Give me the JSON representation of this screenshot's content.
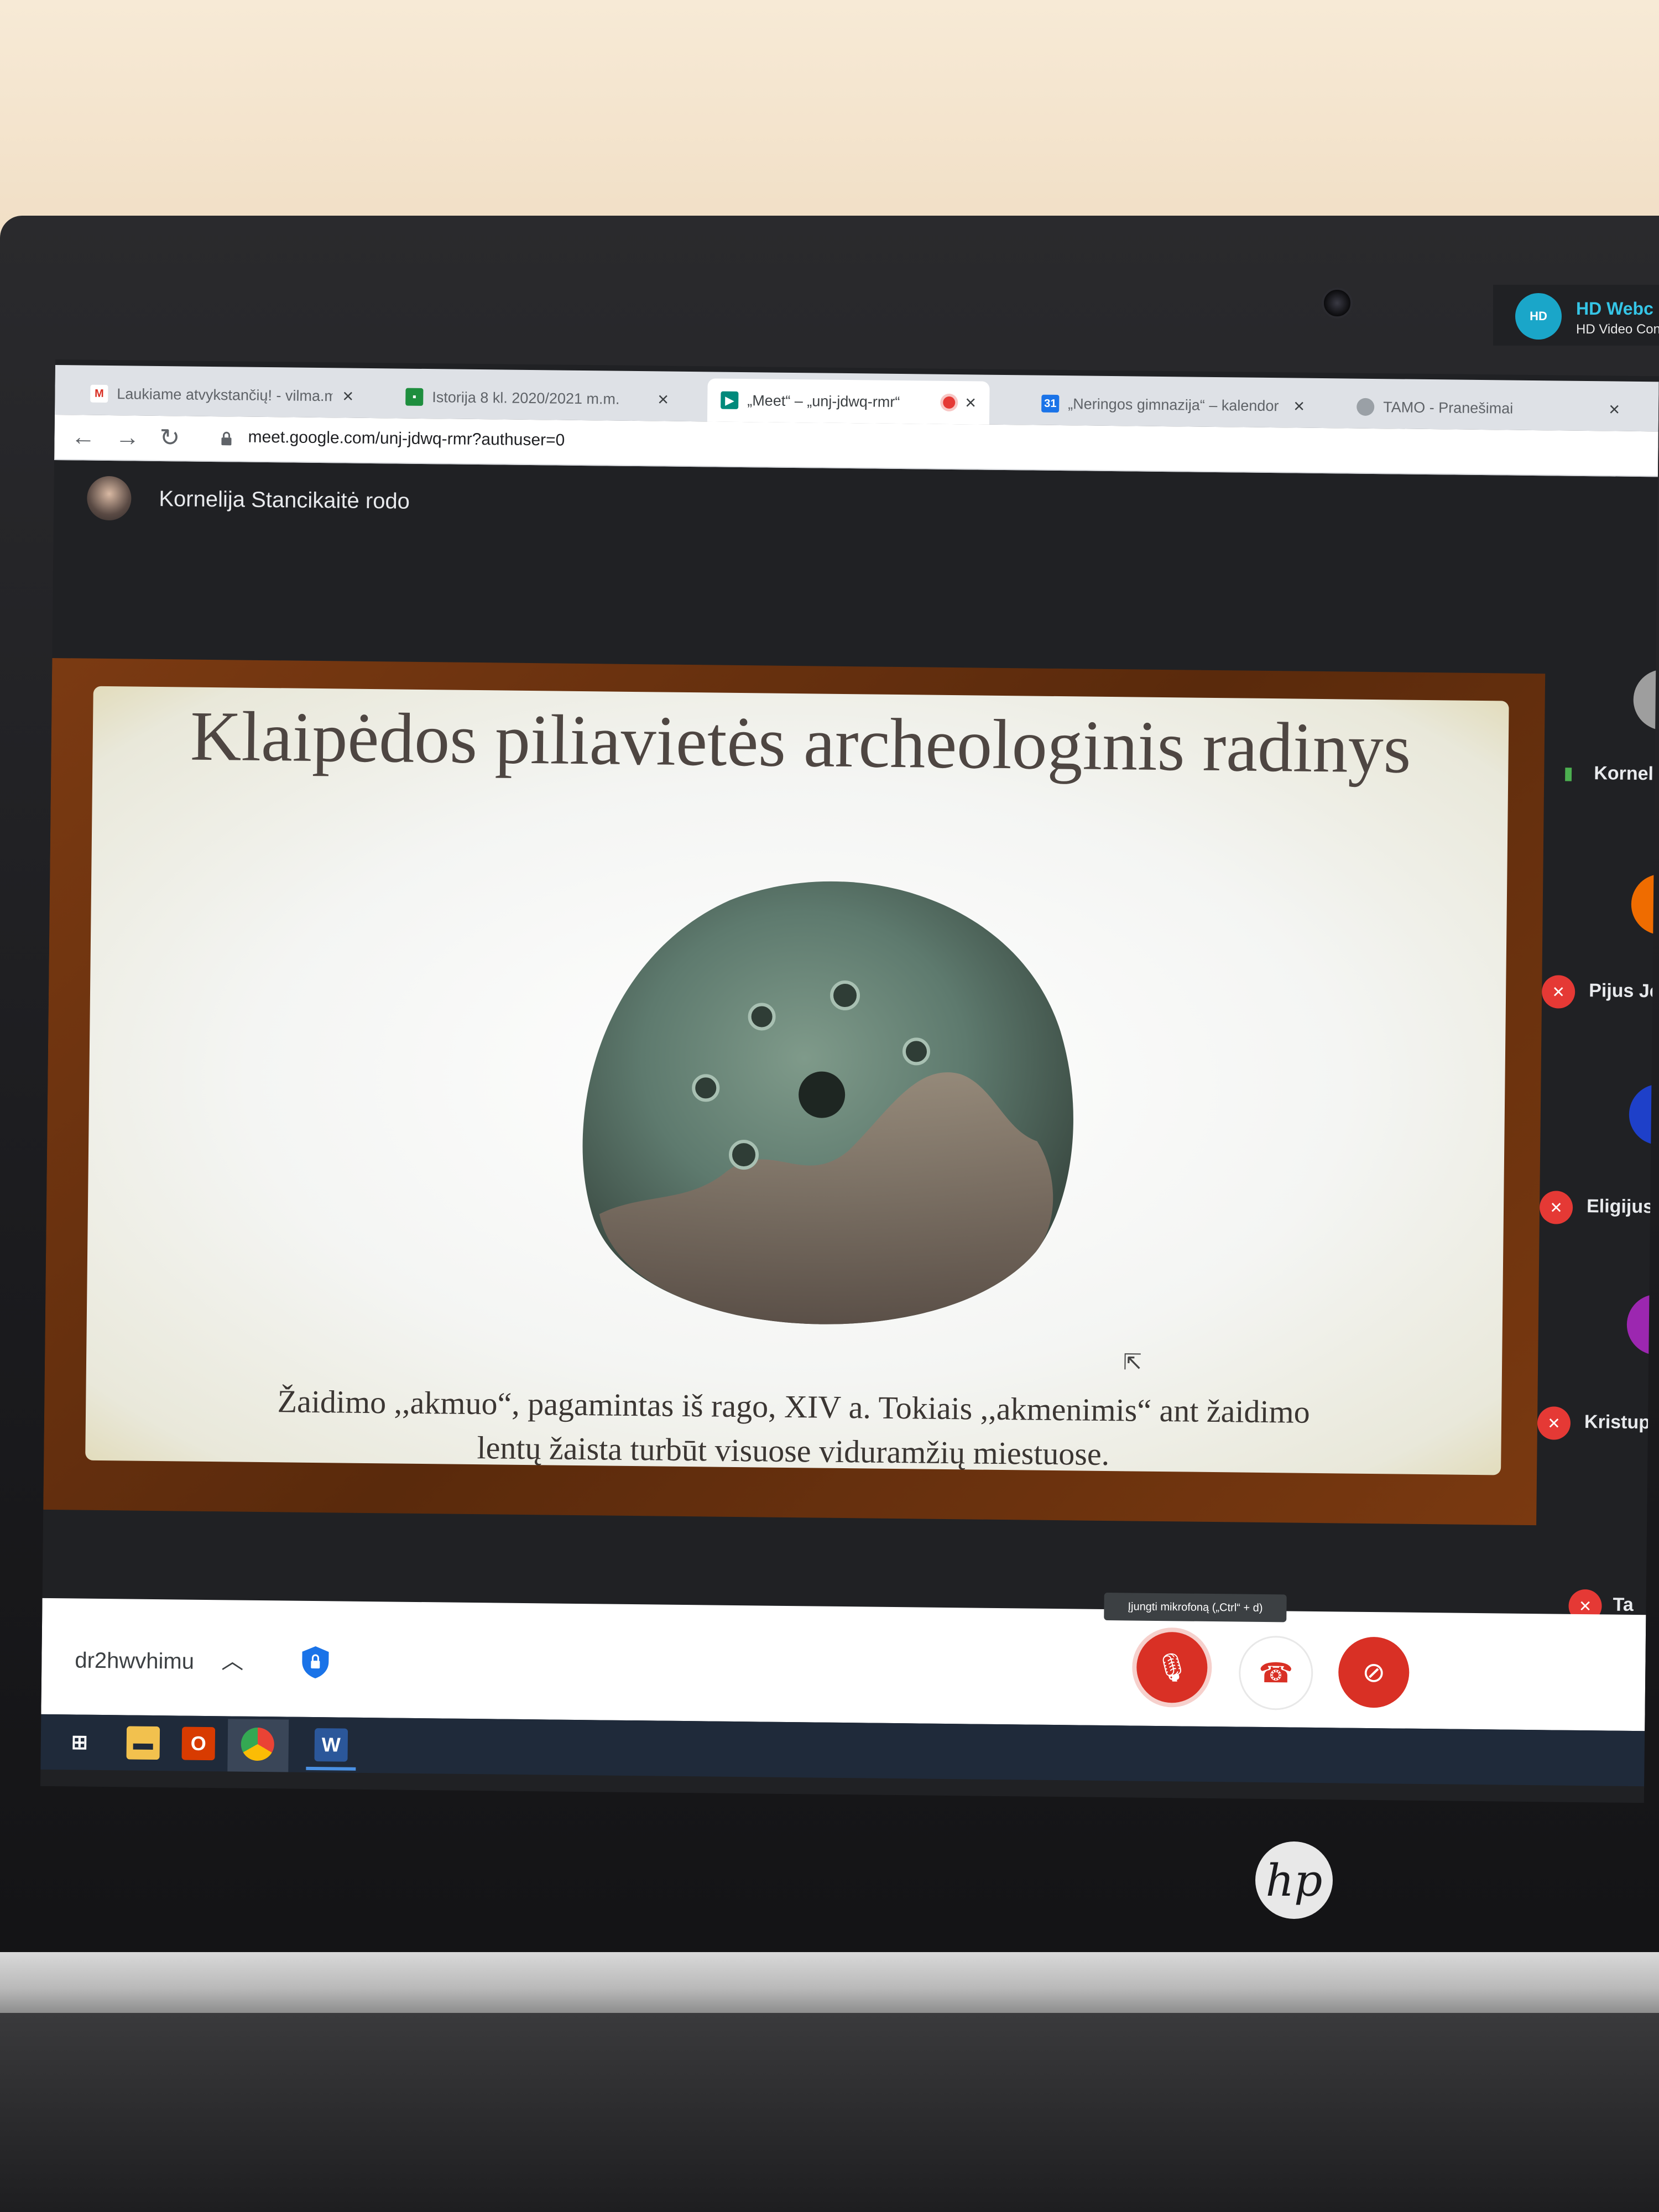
{
  "webcam_badge": {
    "title": "HD Webc",
    "subtitle": "HD Video Con",
    "icon": "webcam-camera-icon"
  },
  "browser": {
    "tabs": [
      {
        "label": "Laukiame atvykstančių! - vilma.m",
        "icon": "gmail-icon",
        "active": false
      },
      {
        "label": "Istorija 8 kl. 2020/2021 m.m.",
        "icon": "classroom-icon",
        "active": false
      },
      {
        "label": "„Meet“ – „unj-jdwq-rmr“",
        "icon": "meet-icon",
        "active": true,
        "recording": true
      },
      {
        "label": "„Neringos gimnazija“ – kalendor",
        "icon": "calendar-icon",
        "active": false
      },
      {
        "label": "TAMO - Pranešimai",
        "icon": "tamo-icon",
        "active": false
      }
    ],
    "url": "meet.google.com/unj-jdwq-rmr?authuser=0"
  },
  "meet": {
    "presenter_label": "Kornelija Stancikaitė rodo",
    "slide": {
      "title": "Klaipėdos piliavietės archeologinis radinys",
      "caption_line1": "Žaidimo ,,akmuo“, pagamintas iš rago, XIV a. Tokiais ,,akmenimis“ ant žaidimo",
      "caption_line2": "lentų žaista turbūt visuose viduramžių miestuose."
    },
    "participants": [
      {
        "name": "Kornel",
        "muted": false,
        "speaking": true,
        "avatar_color": "#9e9e9e"
      },
      {
        "name": "Pijus Je",
        "muted": true,
        "avatar_color": "#ef6c00"
      },
      {
        "name": "Eligijus S",
        "muted": true,
        "avatar_color": "#1e40c9"
      },
      {
        "name": "Kristupas",
        "muted": true,
        "avatar_color": "#9c27b0"
      },
      {
        "name": "Ta",
        "muted": true
      }
    ],
    "meeting_code": "dr2hwvhimu",
    "tooltip": "Įjungti mikrofoną („Ctrl“ + d)",
    "controls": {
      "mic": "mic-off-icon",
      "hangup": "hangup-icon",
      "camera": "camera-off-icon"
    }
  },
  "taskbar": {
    "word_label": "W"
  },
  "brand": {
    "logo": "hp"
  }
}
